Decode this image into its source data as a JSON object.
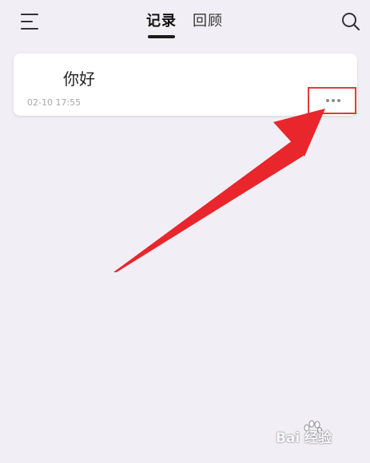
{
  "header": {
    "tabs": [
      {
        "label": "记录",
        "active": true
      },
      {
        "label": "回顾",
        "active": false
      }
    ],
    "menu_icon": "menu-icon",
    "search_icon": "search-icon"
  },
  "notes": [
    {
      "content": "你好",
      "time": "02-10 17:55",
      "more_icon": "more-icon"
    }
  ],
  "annotation": {
    "color": "#e8262c"
  },
  "watermark": {
    "text": "Bai 经验",
    "logo": "baidu-paw-logo"
  },
  "colors": {
    "background": "#f1eff5",
    "card": "#ffffff",
    "time_text": "#a7a7ad"
  }
}
